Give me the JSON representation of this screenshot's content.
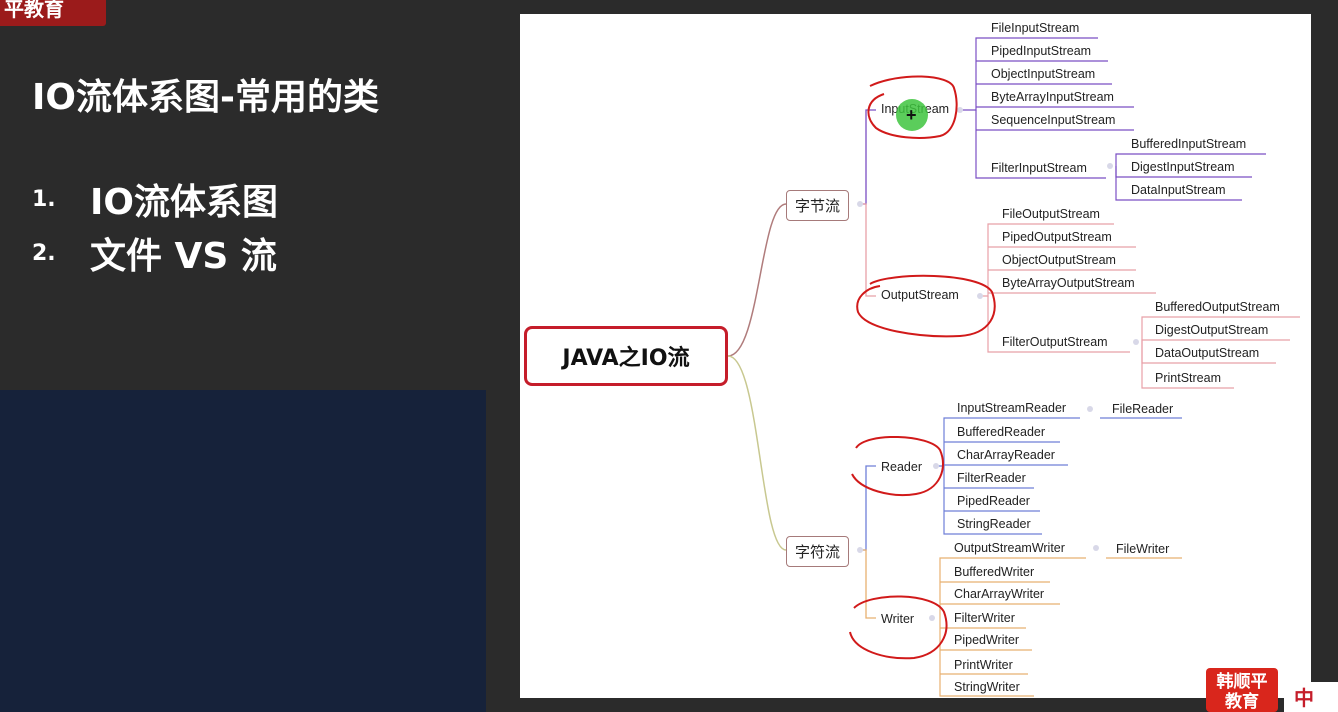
{
  "brand_tag": "平教育",
  "slide_title": "IO流体系图-常用的类",
  "outline": [
    {
      "num": "1.",
      "text": "IO流体系图"
    },
    {
      "num": "2.",
      "text": "文件 VS 流"
    }
  ],
  "mindmap": {
    "root": "JAVA之IO流",
    "byte_stream": "字节流",
    "char_stream": "字符流",
    "input_stream": "InputStream",
    "output_stream": "OutputStream",
    "reader": "Reader",
    "writer": "Writer",
    "input_children": [
      "FileInputStream",
      "PipedInputStream",
      "ObjectInputStream",
      "ByteArrayInputStream",
      "SequenceInputStream",
      "FilterInputStream"
    ],
    "filter_input_children": [
      "BufferedInputStream",
      "DigestInputStream",
      "DataInputStream"
    ],
    "output_children": [
      "FileOutputStream",
      "PipedOutputStream",
      "ObjectOutputStream",
      "ByteArrayOutputStream",
      "FilterOutputStream"
    ],
    "filter_output_children": [
      "BufferedOutputStream",
      "DigestOutputStream",
      "DataOutputStream",
      "PrintStream"
    ],
    "reader_children": [
      "InputStreamReader",
      "BufferedReader",
      "CharArrayReader",
      "FilterReader",
      "PipedReader",
      "StringReader"
    ],
    "file_reader": "FileReader",
    "writer_children": [
      "OutputStreamWriter",
      "BufferedWriter",
      "CharArrayWriter",
      "FilterWriter",
      "PipedWriter",
      "PrintWriter",
      "StringWriter"
    ],
    "file_writer": "FileWriter"
  },
  "logo_badge": "韩顺平\n教育",
  "lang_char": "中",
  "colors": {
    "background": "#2b2b2b",
    "brand_red": "#9b1b1b",
    "video_panel": "#16223a",
    "root_border": "#c51d2a",
    "annotation_red": "#d11a1a",
    "purple_branch": "#7b4fc4",
    "pink_branch": "#e8a0a8",
    "blue_branch": "#6f7fd8",
    "orange_branch": "#e8b070",
    "cursor_green": "#3ec43e"
  }
}
